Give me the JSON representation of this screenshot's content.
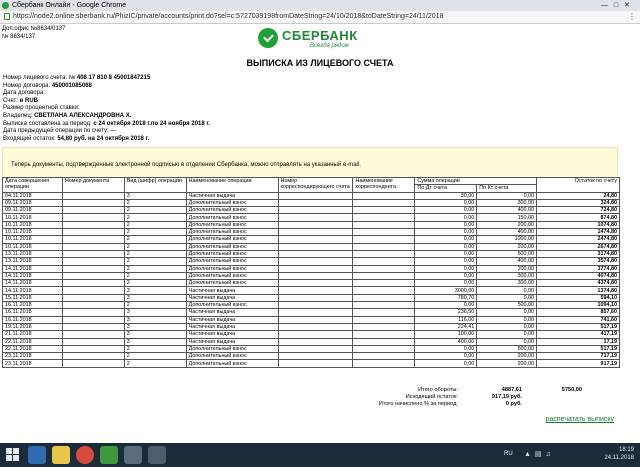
{
  "window": {
    "title": "Сбербанк Онлайн - Google Chrome",
    "url": "https://node2.online.sberbank.ru/PhizIC/private/accounts/print.do?sel=c:5727039198fromDateString=24/10/2018&toDateString=24/11/2018"
  },
  "office": {
    "line1": "Доп.офис №8634/0137",
    "line2": "№ 8634/137"
  },
  "logo": {
    "name": "СБЕРБАНК",
    "slogan": "Всегда рядом",
    "color": "#1f8a37"
  },
  "doc_title": "ВЫПИСКА ИЗ ЛИЦЕВОГО СЧЕТА",
  "info": {
    "account_label": "Номер лицевого счета: №",
    "account_value": "408 17 810 8 45001847215",
    "contract_label": "Номер договора:",
    "contract_value": "450001085068",
    "contract_date_label": "Дата договора:",
    "currency_label": "Счет:",
    "currency_value": "в RUB",
    "rate_label": "Размер процентной ставки:",
    "owner_label": "Владелец:",
    "owner_value": "СВЕТЛАНА АЛЕКСАНДРОВНА Х.",
    "period_label": "Выписка составлена за период:",
    "period_value": "с 24 октября 2018 г.по 24 ноября 2018 г.",
    "prev_op_label": "Дата предыдущей операции по счету:",
    "prev_op_value": "—",
    "opening_label": "Входящий остаток:",
    "opening_value": "54,80 руб. на 24 октября 2018 г."
  },
  "notice": "Теперь документы, подтвержденные электронной подписью в отделении Сбербанка, можно отправлять на указанный e-mail.",
  "table": {
    "headers": {
      "date": "Дата совершения операции",
      "doc_no": "Номер документа",
      "cipher": "Вид (шифр) операции",
      "op_name": "Наименование операции",
      "corr_acc": "Номер корреспондирующего счета",
      "corr_name": "Наименование корреспондента",
      "amount": "Сумма операции",
      "dt": "По Дт счета",
      "kt": "По Кт счета",
      "balance": "Остаток по счету"
    },
    "rows": [
      {
        "date": "04.11.2018",
        "cipher": "3",
        "op": "Частичная выдача",
        "dt": "30,00",
        "kt": "0,00",
        "bal": "24,80"
      },
      {
        "date": "09.11.2018",
        "cipher": "2",
        "op": "Дополнительный взнос",
        "dt": "0,00",
        "kt": "300,00",
        "bal": "324,80"
      },
      {
        "date": "09.11.2018",
        "cipher": "2",
        "op": "Дополнительный взнос",
        "dt": "0,00",
        "kt": "400,00",
        "bal": "724,80"
      },
      {
        "date": "10.11.2018",
        "cipher": "2",
        "op": "Дополнительный взнос",
        "dt": "0,00",
        "kt": "150,00",
        "bal": "874,80"
      },
      {
        "date": "10.11.2018",
        "cipher": "2",
        "op": "Дополнительный взнос",
        "dt": "0,00",
        "kt": "200,00",
        "bal": "1074,80"
      },
      {
        "date": "10.11.2018",
        "cipher": "2",
        "op": "Дополнительный взнос",
        "dt": "0,00",
        "kt": "400,00",
        "bal": "1474,80"
      },
      {
        "date": "10.11.2018",
        "cipher": "2",
        "op": "Дополнительный взнос",
        "dt": "0,00",
        "kt": "1000,00",
        "bal": "2474,80"
      },
      {
        "date": "10.11.2018",
        "cipher": "2",
        "op": "Дополнительный взнос",
        "dt": "0,00",
        "kt": "200,00",
        "bal": "2674,80"
      },
      {
        "date": "13.11.2018",
        "cipher": "2",
        "op": "Дополнительный взнос",
        "dt": "0,00",
        "kt": "500,00",
        "bal": "3174,80"
      },
      {
        "date": "13.11.2018",
        "cipher": "2",
        "op": "Дополнительный взнос",
        "dt": "0,00",
        "kt": "400,00",
        "bal": "3574,80"
      },
      {
        "date": "14.11.2018",
        "cipher": "2",
        "op": "Дополнительный взнос",
        "dt": "0,00",
        "kt": "200,00",
        "bal": "3774,80"
      },
      {
        "date": "14.11.2018",
        "cipher": "2",
        "op": "Дополнительный взнос",
        "dt": "0,00",
        "kt": "300,00",
        "bal": "4074,80"
      },
      {
        "date": "14.11.2018",
        "cipher": "2",
        "op": "Дополнительный взнос",
        "dt": "0,00",
        "kt": "300,00",
        "bal": "4374,80"
      },
      {
        "date": "14.11.2018",
        "cipher": "3",
        "op": "Частичная выдача",
        "dt": "3000,00",
        "kt": "0,00",
        "bal": "1374,80"
      },
      {
        "date": "15.11.2018",
        "cipher": "3",
        "op": "Частичная выдача",
        "dt": "780,70",
        "kt": "0,00",
        "bal": "594,10"
      },
      {
        "date": "16.11.2018",
        "cipher": "2",
        "op": "Дополнительный взнос",
        "dt": "0,00",
        "kt": "500,00",
        "bal": "1094,10"
      },
      {
        "date": "16.11.2018",
        "cipher": "3",
        "op": "Частичная выдача",
        "dt": "236,50",
        "kt": "0,00",
        "bal": "857,60"
      },
      {
        "date": "16.11.2018",
        "cipher": "3",
        "op": "Частичная выдача",
        "dt": "116,00",
        "kt": "0,00",
        "bal": "741,60"
      },
      {
        "date": "19.11.2018",
        "cipher": "3",
        "op": "Частичная выдача",
        "dt": "224,41",
        "kt": "0,00",
        "bal": "517,19"
      },
      {
        "date": "21.11.2018",
        "cipher": "3",
        "op": "Частичная выдача",
        "dt": "100,00",
        "kt": "0,00",
        "bal": "417,19"
      },
      {
        "date": "22.11.2018",
        "cipher": "3",
        "op": "Частичная выдача",
        "dt": "400,00",
        "kt": "0,00",
        "bal": "17,19"
      },
      {
        "date": "22.11.2018",
        "cipher": "2",
        "op": "Дополнительный взнос",
        "dt": "0,00",
        "kt": "500,00",
        "bal": "517,19"
      },
      {
        "date": "23.11.2018",
        "cipher": "2",
        "op": "Дополнительный взнос",
        "dt": "0,00",
        "kt": "200,00",
        "bal": "717,19"
      },
      {
        "date": "23.11.2018",
        "cipher": "2",
        "op": "Дополнительный взнос",
        "dt": "0,00",
        "kt": "200,00",
        "bal": "917,19"
      }
    ]
  },
  "totals": {
    "turnover_label": "Итого обороты:",
    "turnover_dt": "4887,61",
    "turnover_kt": "5750,00",
    "closing_label": "Исходящий остаток:",
    "closing_value": "917,19 руб.",
    "interest_label": "Итого начислено % за период:",
    "interest_value": "0 руб."
  },
  "print_link": "распечатать выписку",
  "taskbar": {
    "lang": "RU",
    "time": "18:19",
    "date": "24.11.2018",
    "bg": "#1c2b3a"
  }
}
